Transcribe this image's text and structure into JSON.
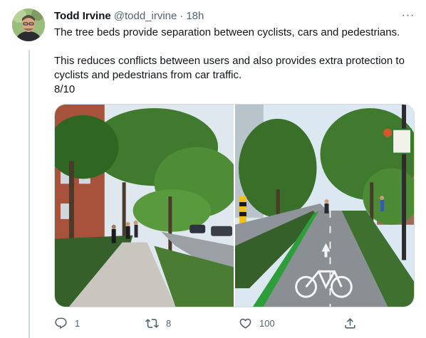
{
  "tweet": {
    "display_name": "Todd Irvine",
    "handle": "@todd_irvine",
    "separator": "·",
    "time": "18h",
    "more_label": "···",
    "text_line1": "The tree beds provide separation between cyclists, cars and pedestrians.",
    "text_line2": "This reduces conflicts between users and also provides extra protection to cyclists and pedestrians from car traffic.",
    "text_line3": "8/10"
  },
  "media": {
    "left_photo": "sidewalk-tree-beds",
    "right_photo": "bike-lane-tree-beds"
  },
  "actions": {
    "reply_count": "1",
    "retweet_count": "8",
    "like_count": "100",
    "share_count": ""
  },
  "icons": {
    "reply": "reply-icon",
    "retweet": "retweet-icon",
    "like": "heart-icon",
    "share": "share-icon",
    "more": "more-icon"
  },
  "colors": {
    "text_primary": "#0f1419",
    "text_secondary": "#536471",
    "border": "#cfd9de",
    "bike_lane_green": "#2e9e3a"
  }
}
